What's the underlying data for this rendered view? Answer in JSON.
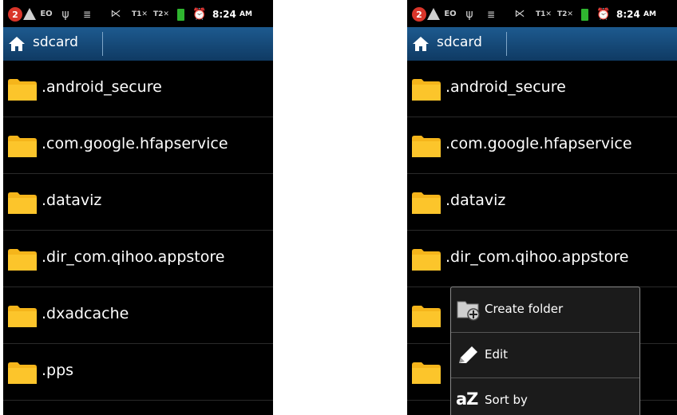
{
  "status_bar": {
    "notification_count": "2",
    "signal1_label": "T1",
    "signal2_label": "T2",
    "time": "8:24",
    "ampm": "AM",
    "icons": [
      "notification-badge-icon",
      "warning-icon",
      "eo-icon",
      "usb-icon",
      "android-debug-icon",
      "mute-icon",
      "signal-sim1-icon",
      "signal-sim2-icon",
      "battery-icon",
      "alarm-icon"
    ]
  },
  "title_bar": {
    "title": "sdcard",
    "icon": "home-icon",
    "color": "#1d5a8f"
  },
  "left_screen": {
    "files": [
      {
        "name": ".android_secure"
      },
      {
        "name": ".com.google.hfapservice"
      },
      {
        "name": ".dataviz"
      },
      {
        "name": ".dir_com.qihoo.appstore"
      },
      {
        "name": ".dxadcache"
      },
      {
        "name": ".pps"
      }
    ]
  },
  "right_screen": {
    "files": [
      {
        "name": ".android_secure"
      },
      {
        "name": ".com.google.hfapservice"
      },
      {
        "name": ".dataviz"
      },
      {
        "name": ".dir_com.qihoo.appstore"
      },
      {
        "name": ""
      },
      {
        "name": ""
      }
    ],
    "context_menu": {
      "items": [
        {
          "label": "Create folder",
          "icon": "create-folder-icon"
        },
        {
          "label": "Edit",
          "icon": "edit-pencil-icon"
        },
        {
          "label": "Sort by",
          "icon": "az-sort-icon",
          "icon_text": "aZ"
        }
      ]
    }
  },
  "colors": {
    "folder": "#f5b51b",
    "background": "#000000",
    "accent": "#1d5a8f"
  }
}
